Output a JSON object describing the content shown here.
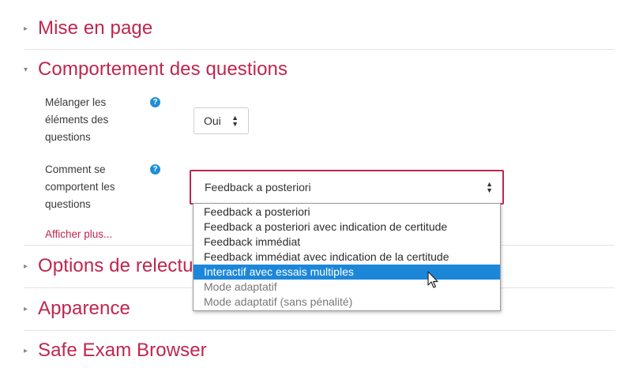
{
  "sections": [
    {
      "title": "Mise en page",
      "expanded": false
    },
    {
      "title": "Comportement des questions",
      "expanded": true
    },
    {
      "title": "Options de relecture",
      "expanded": false
    },
    {
      "title": "Apparence",
      "expanded": false
    },
    {
      "title": "Safe Exam Browser",
      "expanded": false
    }
  ],
  "behaviour": {
    "shuffle_label": "Mélanger les éléments des questions",
    "shuffle_value": "Oui",
    "how_label": "Comment se comportent les questions",
    "how_value": "Feedback a posteriori",
    "help_glyph": "?",
    "show_more": "Afficher plus...",
    "options": [
      {
        "label": "Feedback a posteriori",
        "enabled": true
      },
      {
        "label": "Feedback a posteriori avec indication de certitude",
        "enabled": true
      },
      {
        "label": "Feedback immédiat",
        "enabled": true
      },
      {
        "label": "Feedback immédiat avec indication de la certitude",
        "enabled": true
      },
      {
        "label": "Interactif avec essais multiples",
        "enabled": true,
        "highlighted": true
      },
      {
        "label": "Mode adaptatif",
        "enabled": false
      },
      {
        "label": "Mode adaptatif (sans pénalité)",
        "enabled": false
      }
    ]
  },
  "icons": {
    "collapsed": "chevron-right-icon",
    "expanded": "chevron-down-icon",
    "help": "help-circle-icon",
    "select": "select-arrows-icon",
    "pointer": "mouse-pointer-icon"
  },
  "colors": {
    "accent": "#c0254e",
    "help": "#1f8fd6",
    "highlight": "#1c87d9"
  }
}
